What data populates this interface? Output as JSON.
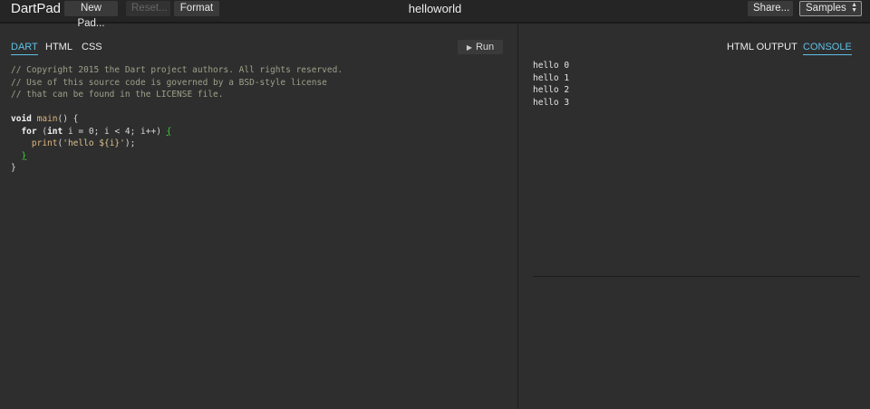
{
  "header": {
    "logo": "DartPad",
    "buttons": {
      "new_pad": "New Pad...",
      "reset": "Reset...",
      "format": "Format",
      "share": "Share..."
    },
    "title": "helloworld",
    "samples_label": "Samples"
  },
  "editor": {
    "tabs": [
      "DART",
      "HTML",
      "CSS"
    ],
    "active_tab": "DART",
    "run_label": "Run",
    "code": {
      "comment1": "// Copyright 2015 the Dart project authors. All rights reserved.",
      "comment2": "// Use of this source code is governed by a BSD-style license",
      "comment3": "// that can be found in the LICENSE file.",
      "kw_void": "void",
      "fn_main": "main",
      "main_rest": "() {",
      "kw_for": "for",
      "for_open": " (",
      "kw_int": "int",
      "for_rest": " i = 0; i < 4; i++) ",
      "brace_open": "{",
      "fn_print": "print",
      "print_open": "(",
      "str_hello": "'hello ${i}'",
      "print_close": ");",
      "brace_close": "}",
      "main_close": "}"
    }
  },
  "output": {
    "tabs": [
      "HTML OUTPUT",
      "CONSOLE"
    ],
    "active_tab": "CONSOLE",
    "console_lines": [
      "hello 0",
      "hello 1",
      "hello 2",
      "hello 3"
    ]
  },
  "colors": {
    "accent": "#5fc0e6",
    "bracket_match": "#3ad33a",
    "background": "#2e2e2e"
  }
}
